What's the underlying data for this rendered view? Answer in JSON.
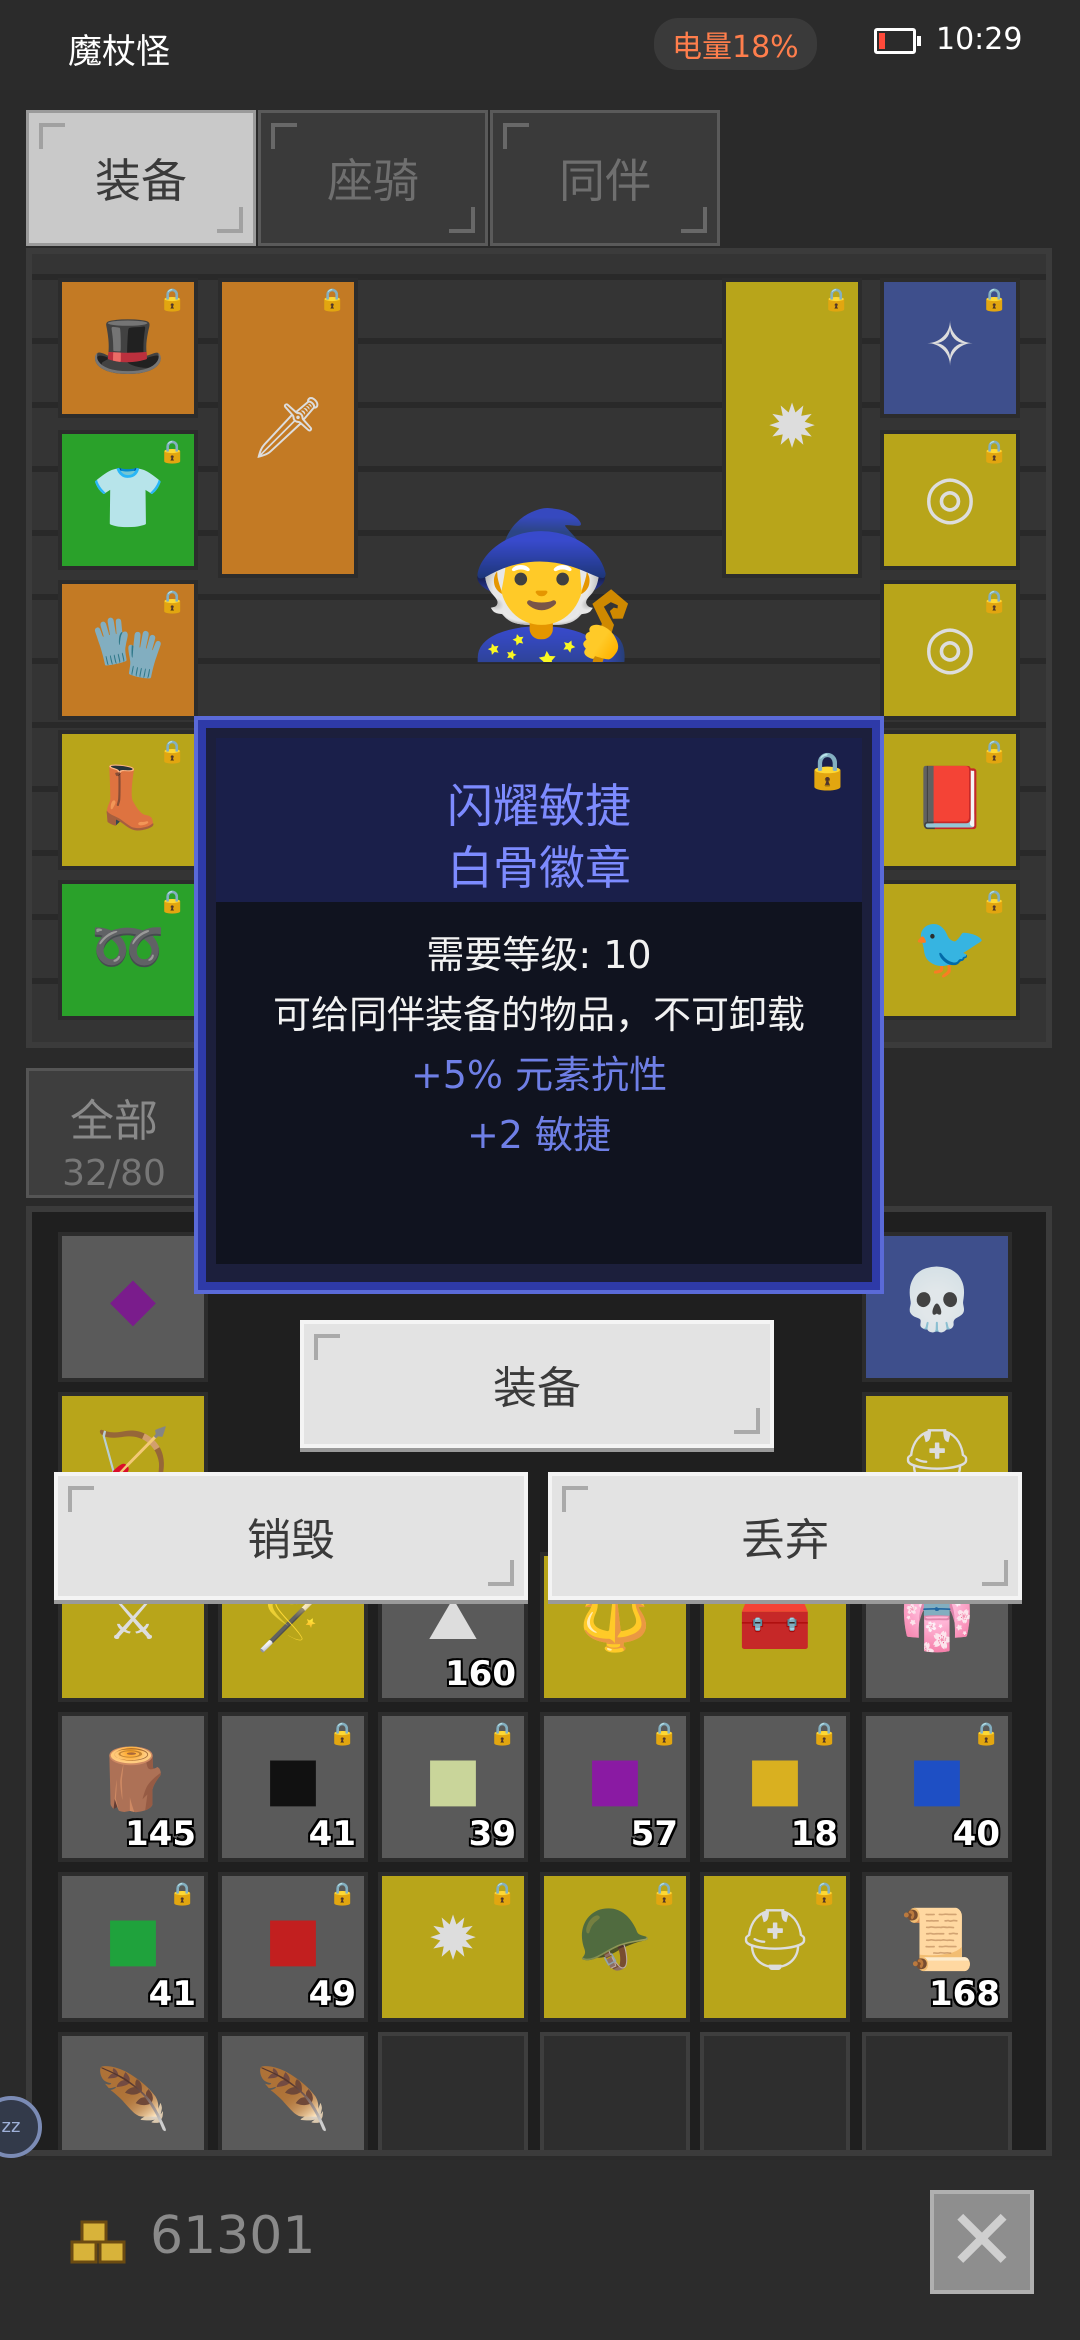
{
  "status_bar": {
    "app_name": "魔杖怪",
    "battery": "电量18%",
    "time": "10:29"
  },
  "tabs": [
    {
      "label": "装备",
      "active": true
    },
    {
      "label": "座骑",
      "active": false
    },
    {
      "label": "同伴",
      "active": false
    }
  ],
  "inventory_filter": {
    "label": "全部",
    "count": "32/80"
  },
  "tooltip": {
    "title_line1": "闪耀敏捷",
    "title_line2": "白骨徽章",
    "requirement": "需要等级: 10",
    "description": "可给同伴装备的物品，不可卸载",
    "stat1": "+5% 元素抗性",
    "stat2": "+2 敏捷"
  },
  "actions": {
    "equip": "装备",
    "destroy": "销毁",
    "discard": "丢弃"
  },
  "inventory_counts": [
    "160",
    "145",
    "41",
    "39",
    "57",
    "18",
    "40",
    "41",
    "49",
    "168"
  ],
  "gold": {
    "amount": "61301"
  },
  "colors": {
    "tooltip_title": "#7d8bff",
    "tooltip_stat": "#6f7fe6",
    "battery_text": "#ff7e4c"
  },
  "icons": {
    "lock": "lock-icon",
    "close": "close-icon",
    "gold": "gold-coins-icon"
  }
}
